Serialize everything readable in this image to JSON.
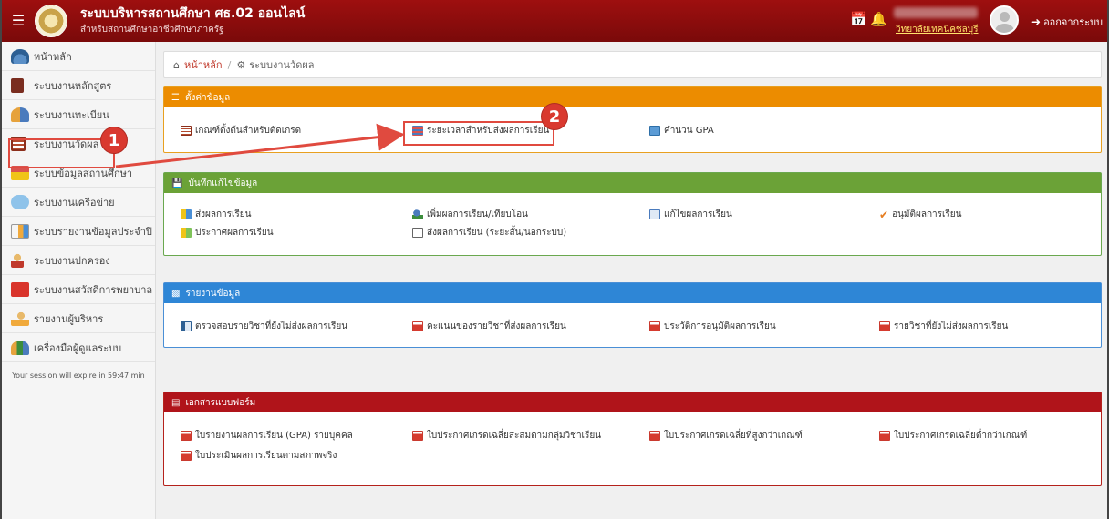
{
  "header": {
    "menu_icon": "hamburger-icon",
    "title": "ระบบบริหารสถานศึกษา ศธ.02 ออนไลน์",
    "subtitle": "สำหรับสถานศึกษาอาชีวศึกษาภาครัฐ",
    "college": "วิทยาลัยเทคนิคชลบุรี",
    "logout_label": "ออกจากระบบ",
    "bg_color": "#8b0e0e"
  },
  "sidebar": {
    "items": [
      {
        "label": "หน้าหลัก",
        "icon": "dashboard-icon"
      },
      {
        "label": "ระบบงานหลักสูตร",
        "icon": "book-icon"
      },
      {
        "label": "ระบบงานทะเบียน",
        "icon": "users-icon"
      },
      {
        "label": "ระบบงานวัดผล",
        "icon": "clipboard-icon"
      },
      {
        "label": "ระบบข้อมูลสถานศึกษา",
        "icon": "school-icon"
      },
      {
        "label": "ระบบงานเครือข่าย",
        "icon": "cloud-icon"
      },
      {
        "label": "ระบบรายงานข้อมูลประจำปี",
        "icon": "report-icon"
      },
      {
        "label": "ระบบงานปกครอง",
        "icon": "person-icon"
      },
      {
        "label": "ระบบงานสวัสดิการพยาบาล",
        "icon": "first-aid-icon"
      },
      {
        "label": "รายงานผู้บริหาร",
        "icon": "chart-person-icon"
      },
      {
        "label": "เครื่องมือผู้ดูแลระบบ",
        "icon": "tools-icon"
      }
    ],
    "session_text": "Your session will expire in 59:47 min"
  },
  "breadcrumb": {
    "home": "หน้าหลัก",
    "current": "ระบบงานวัดผล"
  },
  "panels": {
    "settings": {
      "title": "ตั้งค่าข้อมูล",
      "color": "#ec8c00",
      "links": [
        "เกณฑ์ตั้งต้นสำหรับตัดเกรด",
        "ระยะเวลาสำหรับส่งผลการเรียน",
        "คำนวน GPA"
      ]
    },
    "record": {
      "title": "บันทึกแก้ไขข้อมูล",
      "color": "#6ba237",
      "links": [
        "ส่งผลการเรียน",
        "เพิ่มผลการเรียน/เทียบโอน",
        "แก้ไขผลการเรียน",
        "อนุมัติผลการเรียน",
        "ประกาศผลการเรียน",
        "ส่งผลการเรียน (ระยะสั้น/นอกระบบ)"
      ]
    },
    "reports": {
      "title": "รายงานข้อมูล",
      "color": "#2e86d6",
      "links": [
        "ตรวจสอบรายวิชาที่ยังไม่ส่งผลการเรียน",
        "คะแนนของรายวิชาที่ส่งผลการเรียน",
        "ประวัติการอนุมัติผลการเรียน",
        "รายวิชาที่ยังไม่ส่งผลการเรียน"
      ]
    },
    "forms": {
      "title": "เอกสารแบบฟอร์ม",
      "color": "#b0141a",
      "links": [
        "ใบรายงานผลการเรียน (GPA) รายบุคคล",
        "ใบประกาศเกรดเฉลี่ยสะสมตามกลุ่มวิชาเรียน",
        "ใบประกาศเกรดเฉลี่ยที่สูงกว่าเกณฑ์",
        "ใบประกาศเกรดเฉลี่ยต่ำกว่าเกณฑ์",
        "ใบประเมินผลการเรียนตามสภาพจริง"
      ]
    }
  },
  "annotations": {
    "badge1": "1",
    "badge2": "2"
  }
}
